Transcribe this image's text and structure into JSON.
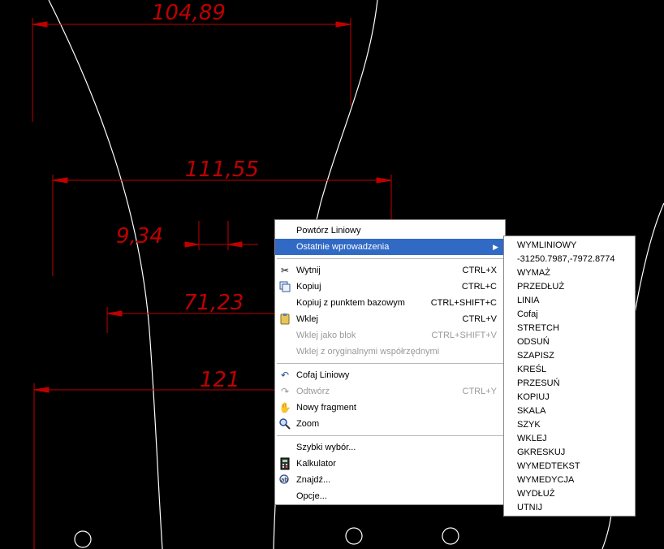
{
  "dimensions": {
    "d1": "104,89",
    "d2": "111,55",
    "d3": "9,34",
    "d4": "71,23",
    "d5": "121"
  },
  "colors": {
    "dimension": "#c00000",
    "geometry": "#ffffff",
    "background": "#000000",
    "highlight": "#316ac5"
  },
  "context_menu": {
    "repeat": "Powtórz Liniowy",
    "recent": "Ostatnie wprowadzenia",
    "cut": {
      "label": "Wytnij",
      "shortcut": "CTRL+X",
      "icon": "scissors-icon"
    },
    "copy": {
      "label": "Kopiuj",
      "shortcut": "CTRL+C",
      "icon": "copy-icon"
    },
    "copy_base": {
      "label": "Kopiuj z punktem bazowym",
      "shortcut": "CTRL+SHIFT+C"
    },
    "paste": {
      "label": "Wklej",
      "shortcut": "CTRL+V",
      "icon": "paste-icon"
    },
    "paste_block": {
      "label": "Wklej jako blok",
      "shortcut": "CTRL+SHIFT+V"
    },
    "paste_orig": {
      "label": "Wklej z oryginalnymi współrzędnymi"
    },
    "undo": {
      "label": "Cofaj Liniowy",
      "icon": "undo-icon"
    },
    "redo": {
      "label": "Odtwórz",
      "shortcut": "CTRL+Y",
      "icon": "redo-icon"
    },
    "pan": {
      "label": "Nowy fragment",
      "icon": "pan-icon"
    },
    "zoom": {
      "label": "Zoom",
      "icon": "zoom-icon"
    },
    "quick_select": "Szybki wybór...",
    "calculator": {
      "label": "Kalkulator",
      "icon": "calculator-icon"
    },
    "find": {
      "label": "Znajdź...",
      "icon": "find-icon"
    },
    "options": "Opcje..."
  },
  "submenu_items": [
    "WYMLINIOWY",
    "-31250.7987,-7972.8774",
    "WYMAŻ",
    "PRZEDŁUŻ",
    "LINIA",
    "Cofaj",
    "STRETCH",
    "ODSUŃ",
    "SZAPISZ",
    "KREŚL",
    "PRZESUŃ",
    "KOPIUJ",
    "SKALA",
    "SZYK",
    "WKLEJ",
    "GKRESKUJ",
    "WYMEDTEKST",
    "WYMEDYCJA",
    "WYDŁUŻ",
    "UTNIJ"
  ]
}
